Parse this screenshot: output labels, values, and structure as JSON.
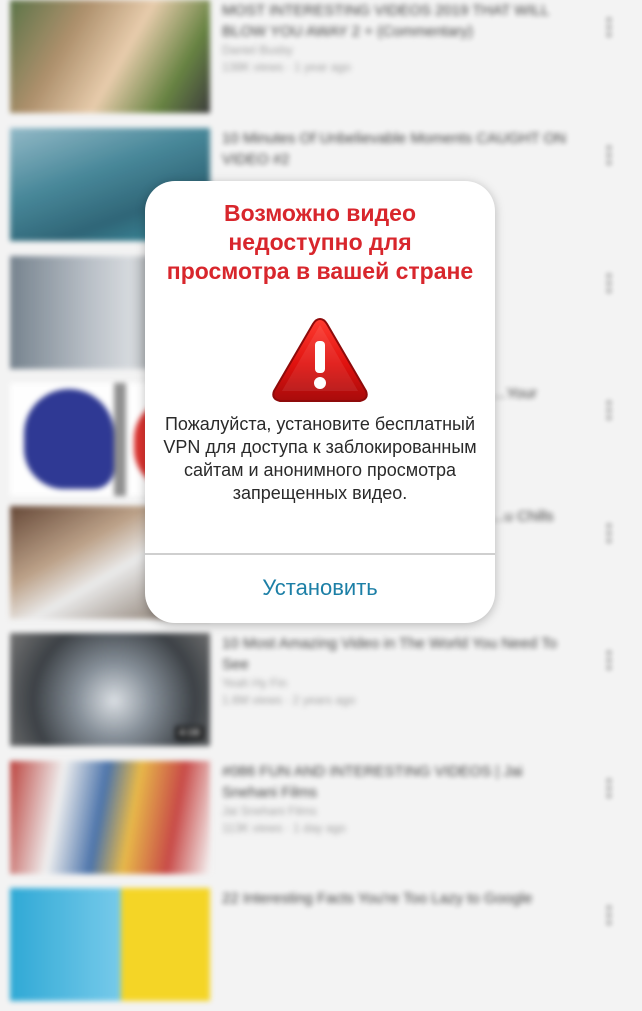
{
  "videos": [
    {
      "title": "MOST INTERESTING VIDEOS 2019 THAT WILL BLOW YOU AWAY 2 + (Commentary)",
      "channel": "Daniel Busby",
      "stats": "138K views · 1 year ago",
      "duration": ""
    },
    {
      "title": "10 Minutes Of Unbelievable Moments CAUGHT ON VIDEO #2",
      "channel": "",
      "stats": "",
      "duration": ""
    },
    {
      "title": "",
      "channel": "",
      "stats": "",
      "duration": ""
    },
    {
      "title": "...Your",
      "channel": "",
      "stats": "",
      "duration": ""
    },
    {
      "title": "...u Chills",
      "channel": "",
      "stats": "",
      "duration": ""
    },
    {
      "title": "10 Most Amazing Video in The World You Need To See",
      "channel": "Yeah Hy Fin",
      "stats": "1.6M views · 2 years ago",
      "duration": "4:08"
    },
    {
      "title": "#086 FUN AND INTERESTING VIDEOS | Jai Snehani Films",
      "channel": "Jai Snehani Films",
      "stats": "113K views · 1 day ago",
      "duration": ""
    },
    {
      "title": "22 Interesting Facts You're Too Lazy to Google",
      "channel": "",
      "stats": "",
      "duration": ""
    }
  ],
  "dialog": {
    "title": "Возможно видео недоступно для просмотра в вашей стране",
    "body": "Пожалуйста, установите бесплатный VPN для доступа к заблокированным сайтам и анонимного просмотра запрещенных видео.",
    "button": "Установить",
    "title_color": "#d8262c",
    "button_color": "#1c7fa6",
    "icon": "warning-triangle-icon"
  },
  "more_icon": "⋮"
}
